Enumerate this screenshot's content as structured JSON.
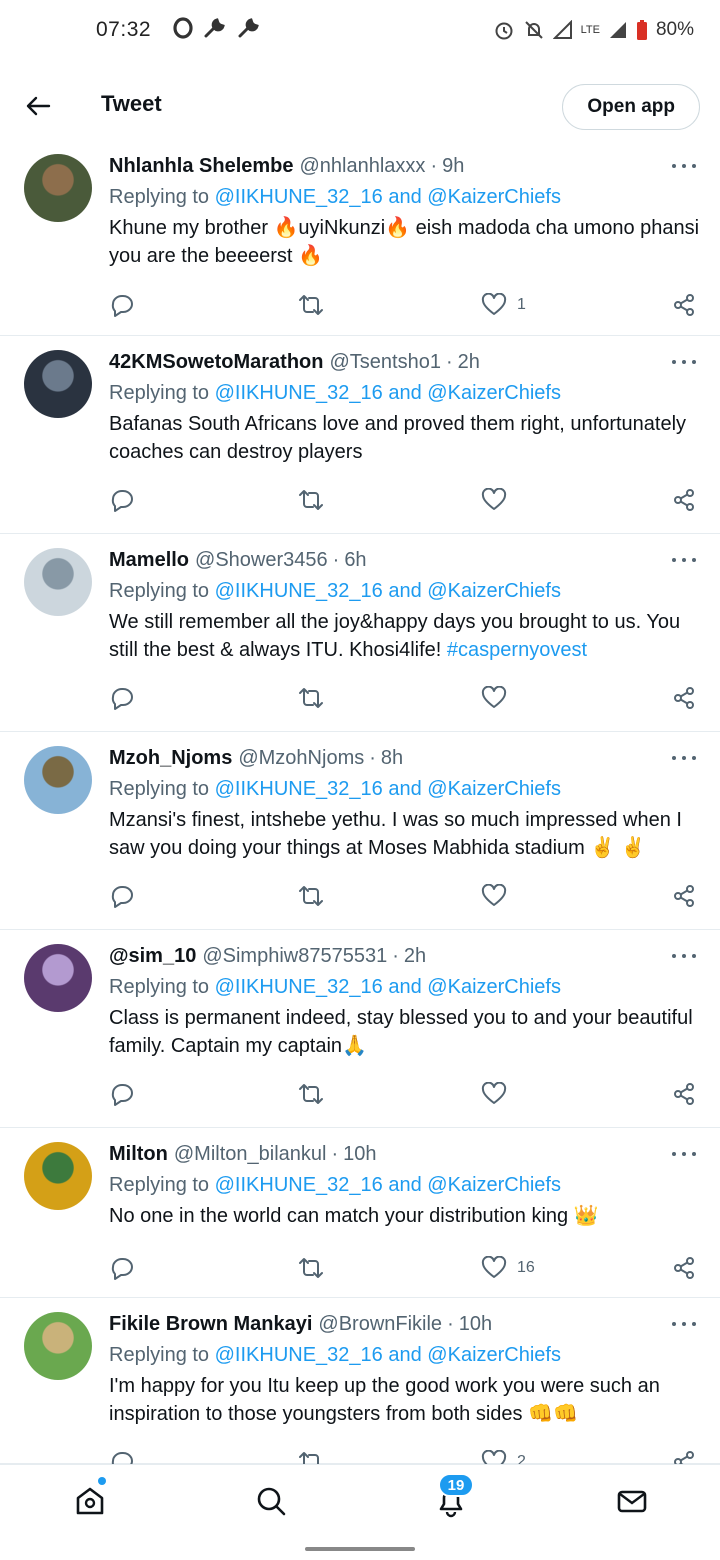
{
  "status_bar": {
    "time": "07:32",
    "network": "LTE",
    "battery": "80%"
  },
  "header": {
    "title": "Tweet",
    "open_app": "Open app"
  },
  "tweets": [
    {
      "name": "Nhlanhla Shelembe",
      "handle": "@nhlanhlaxxx",
      "time": "9h",
      "replying_prefix": "Replying to",
      "mention1": "@IIKHUNE_32_16",
      "mention_join": "and",
      "mention2": "@KaizerChiefs",
      "text": "Khune my brother 🔥uyiNkunzi🔥 eish madoda cha umono phansi you are the beeeerst 🔥",
      "hashtag": "",
      "likes": "1",
      "avatar_colors": [
        "#4a5a3a",
        "#8d6e4c"
      ]
    },
    {
      "name": "42KMSowetoMarathon",
      "handle": "@Tsentsho1",
      "time": "2h",
      "replying_prefix": "Replying to",
      "mention1": "@IIKHUNE_32_16",
      "mention_join": "and",
      "mention2": "@KaizerChiefs",
      "text": "Bafanas South Africans love and proved them right, unfortunately coaches can destroy players",
      "hashtag": "",
      "likes": "",
      "avatar_colors": [
        "#2a3340",
        "#6b7a8c"
      ]
    },
    {
      "name": "Mamello",
      "handle": "@Shower3456",
      "time": "6h",
      "replying_prefix": "Replying to",
      "mention1": "@IIKHUNE_32_16",
      "mention_join": "and",
      "mention2": "@KaizerChiefs",
      "text": "We still remember all the joy&happy days you brought to us. You still the best & always ITU. Khosi4life! ",
      "hashtag": "#caspernyovest",
      "likes": "",
      "avatar_colors": [
        "#ccd6dd",
        "#8899a6"
      ]
    },
    {
      "name": "Mzoh_Njoms",
      "handle": "@MzohNjoms",
      "time": "8h",
      "replying_prefix": "Replying to",
      "mention1": "@IIKHUNE_32_16",
      "mention_join": "and",
      "mention2": "@KaizerChiefs",
      "text": "Mzansi's finest, intshebe yethu. I was so much impressed when I saw you doing your things at Moses Mabhida stadium ✌️ ✌️",
      "hashtag": "",
      "likes": "",
      "avatar_colors": [
        "#87b3d6",
        "#7a6a45"
      ]
    },
    {
      "name": "@sim_10",
      "handle": "@Simphiw87575531",
      "time": "2h",
      "replying_prefix": "Replying to",
      "mention1": "@IIKHUNE_32_16",
      "mention_join": "and",
      "mention2": "@KaizerChiefs",
      "text": "Class is permanent indeed, stay blessed you to and your beautiful family. Captain my captain🙏",
      "hashtag": "",
      "likes": "",
      "avatar_colors": [
        "#5a3a6e",
        "#b39ad0"
      ]
    },
    {
      "name": "Milton",
      "handle": "@Milton_bilankul",
      "time": "10h",
      "replying_prefix": "Replying to",
      "mention1": "@IIKHUNE_32_16",
      "mention_join": "and",
      "mention2": "@KaizerChiefs",
      "text": "No one in the world can match your distribution king 👑",
      "hashtag": "",
      "likes": "16",
      "avatar_colors": [
        "#d4a017",
        "#3d7a3d"
      ]
    },
    {
      "name": "Fikile Brown Mankayi",
      "handle": "@BrownFikile",
      "time": "10h",
      "replying_prefix": "Replying to",
      "mention1": "@IIKHUNE_32_16",
      "mention_join": "and",
      "mention2": "@KaizerChiefs",
      "text": "I'm happy for you Itu keep up the good work you were such an inspiration to those youngsters from both sides 👊👊",
      "hashtag": "",
      "likes": "2",
      "avatar_colors": [
        "#6aa84f",
        "#c9b27a"
      ]
    }
  ],
  "bottom_nav": {
    "notification_count": "19"
  },
  "colors": {
    "accent": "#1d9bf0",
    "text": "#0f1419",
    "secondary": "#536471",
    "divider": "#e6ecf0"
  }
}
